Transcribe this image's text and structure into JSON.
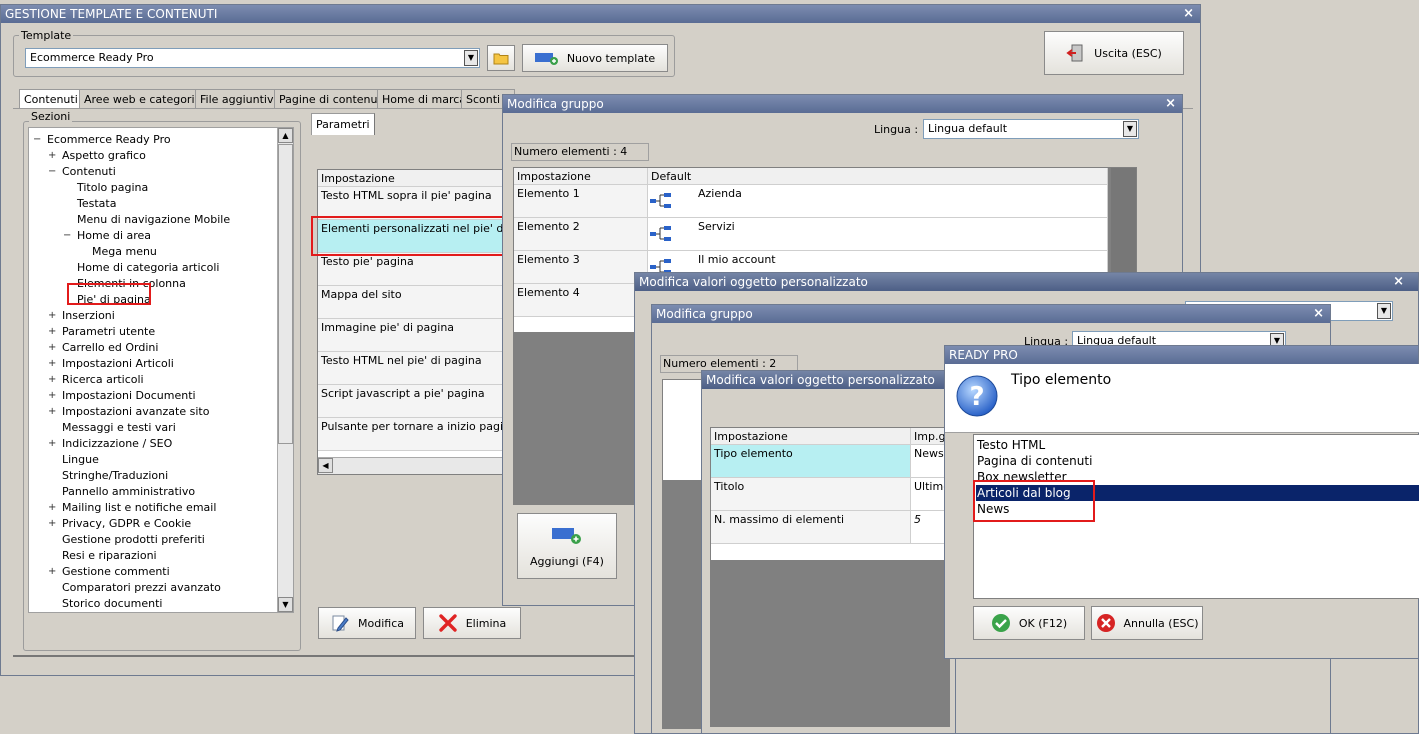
{
  "main_window": {
    "title": "GESTIONE TEMPLATE E CONTENUTI",
    "template_group_label": "Template",
    "template_value": "Ecommerce Ready Pro",
    "new_template_label": "Nuovo template",
    "exit_label": "Uscita (ESC)",
    "tabs": [
      "Contenuti",
      "Aree web e categorie",
      "File aggiuntivi",
      "Pagine di contenuti",
      "Home di marca",
      "Sconti e"
    ],
    "sections_label": "Sezioni",
    "tree": [
      {
        "label": "Ecommerce Ready Pro",
        "level": 0,
        "expander": "−"
      },
      {
        "label": "Aspetto grafico",
        "level": 1,
        "expander": "+"
      },
      {
        "label": "Contenuti",
        "level": 1,
        "expander": "−"
      },
      {
        "label": "Titolo pagina",
        "level": 2,
        "expander": ""
      },
      {
        "label": "Testata",
        "level": 2,
        "expander": ""
      },
      {
        "label": "Menu di navigazione Mobile",
        "level": 2,
        "expander": ""
      },
      {
        "label": "Home di area",
        "level": 2,
        "expander": "−"
      },
      {
        "label": "Mega menu",
        "level": 3,
        "expander": ""
      },
      {
        "label": "Home di categoria articoli",
        "level": 2,
        "expander": ""
      },
      {
        "label": "Elementi in colonna",
        "level": 2,
        "expander": ""
      },
      {
        "label": "Pie' di pagina",
        "level": 2,
        "expander": ""
      },
      {
        "label": "Inserzioni",
        "level": 1,
        "expander": "+"
      },
      {
        "label": "Parametri utente",
        "level": 1,
        "expander": "+"
      },
      {
        "label": "Carrello ed Ordini",
        "level": 1,
        "expander": "+"
      },
      {
        "label": "Impostazioni Articoli",
        "level": 1,
        "expander": "+"
      },
      {
        "label": "Ricerca articoli",
        "level": 1,
        "expander": "+"
      },
      {
        "label": "Impostazioni Documenti",
        "level": 1,
        "expander": "+"
      },
      {
        "label": "Impostazioni avanzate sito",
        "level": 1,
        "expander": "+"
      },
      {
        "label": "Messaggi e testi vari",
        "level": 1,
        "expander": ""
      },
      {
        "label": "Indicizzazione / SEO",
        "level": 1,
        "expander": "+"
      },
      {
        "label": "Lingue",
        "level": 1,
        "expander": ""
      },
      {
        "label": "Stringhe/Traduzioni",
        "level": 1,
        "expander": ""
      },
      {
        "label": "Pannello amministrativo",
        "level": 1,
        "expander": ""
      },
      {
        "label": "Mailing list e notifiche email",
        "level": 1,
        "expander": "+"
      },
      {
        "label": "Privacy, GDPR e Cookie",
        "level": 1,
        "expander": "+"
      },
      {
        "label": "Gestione prodotti preferiti",
        "level": 1,
        "expander": ""
      },
      {
        "label": "Resi e riparazioni",
        "level": 1,
        "expander": ""
      },
      {
        "label": "Gestione commenti",
        "level": 1,
        "expander": "+"
      },
      {
        "label": "Comparatori prezzi avanzato",
        "level": 1,
        "expander": ""
      },
      {
        "label": "Storico documenti",
        "level": 1,
        "expander": ""
      }
    ],
    "params_tab": "Parametri",
    "params_header": "Impostazione",
    "params_rows": [
      "Testo HTML sopra il pie' pagina",
      "Elementi personalizzati nel pie' di pagina",
      "Testo pie' pagina",
      "Mappa del sito",
      "Immagine pie' di pagina",
      "Testo HTML nel pie' di pagina",
      "Script javascript a pie' pagina",
      "Pulsante per tornare a inizio pagina"
    ],
    "modify_label": "Modifica",
    "delete_label": "Elimina"
  },
  "group_dialog_1": {
    "title": "Modifica gruppo",
    "language_label": "Lingua :",
    "language_value": "Lingua default",
    "count_label": "Numero elementi : 4",
    "col_setting": "Impostazione",
    "col_default": "Default",
    "rows": [
      {
        "setting": "Elemento 1",
        "value": "Azienda"
      },
      {
        "setting": "Elemento 2",
        "value": "Servizi"
      },
      {
        "setting": "Elemento 3",
        "value": "Il mio account"
      },
      {
        "setting": "Elemento 4",
        "value": ""
      }
    ],
    "add_label": "Aggiungi (F4)"
  },
  "custom_dialog_1": {
    "title": "Modifica valori oggetto personalizzato"
  },
  "group_dialog_2": {
    "title": "Modifica gruppo",
    "language_label": "Lingua :",
    "language_value": "Lingua default",
    "count_label": "Numero elementi : 2"
  },
  "custom_dialog_2": {
    "title": "Modifica valori oggetto personalizzato",
    "col_setting": "Impostazione",
    "col_value": "Imp.ge",
    "rows": [
      {
        "setting": "Tipo elemento",
        "value": "News"
      },
      {
        "setting": "Titolo",
        "value": "Ultime"
      },
      {
        "setting": "N. massimo di elementi",
        "value": "5"
      }
    ]
  },
  "readypro_dialog": {
    "title": "READY PRO",
    "question": "Tipo elemento",
    "options": [
      "Testo HTML",
      "Pagina di contenuti",
      "Box newsletter",
      "Articoli dal blog",
      "News"
    ],
    "selected_index": 3,
    "ok_label": "OK (F12)",
    "cancel_label": "Annulla (ESC)"
  },
  "colors": {
    "title_bar": "#5a6c94",
    "selection": "#0a246a",
    "highlight_row": "#b7eff2",
    "annotation": "#e21b1b"
  }
}
